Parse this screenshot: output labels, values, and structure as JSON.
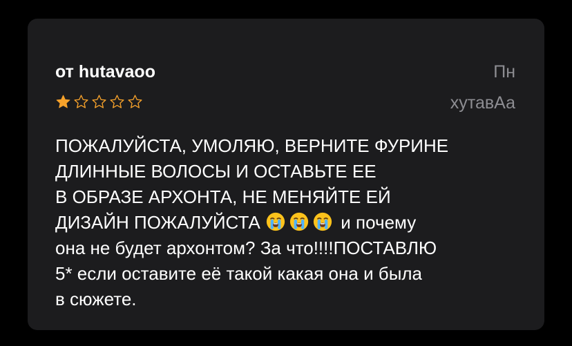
{
  "review": {
    "author": "от hutavaoo",
    "date": "Пн",
    "nickname": "хутавАа",
    "rating": 1,
    "rating_max": 5,
    "star_color": "#f7a22b",
    "empty_star_color": "#f7a22b",
    "body_lines": [
      "ПОЖАЛУЙСТА, УМОЛЯЮ, ВЕРНИТЕ ФУРИНЕ",
      "ДЛИННЫЕ ВОЛОСЫ И ОСТАВЬТЕ ЕЕ",
      "В ОБРАЗЕ АРХОНТА, НЕ МЕНЯЙТЕ ЕЙ",
      "ДИЗАЙН ПОЖАЛУЙСТА",
      " и почему",
      "она не будет архонтом? За что!!!!ПОСТАВЛЮ",
      "5* если оставите её такой какая она и была",
      "в сюжете."
    ],
    "emoji_name": "loudly-crying-face-icon",
    "emoji_count": 3
  }
}
